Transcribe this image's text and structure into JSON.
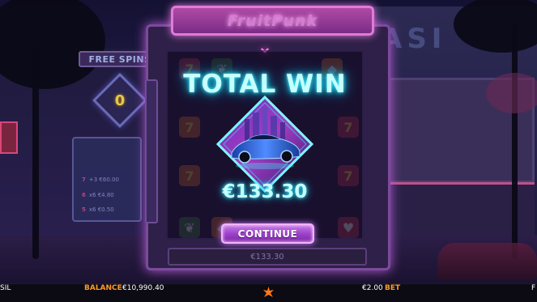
{
  "game": {
    "logo": "FruitPunk",
    "free_spins_label": "FREE SPINS",
    "free_spins_count": "0",
    "paytable": [
      {
        "num": "7",
        "text": "+3 €60.00"
      },
      {
        "num": "6",
        "text": "x6 €4.80"
      },
      {
        "num": "5",
        "text": "x6 €0.50"
      }
    ],
    "background_sign": "ASI"
  },
  "win": {
    "title": "TOTAL WIN",
    "amount": "€133.30",
    "continue_label": "CONTINUE",
    "reel_balance": "€133.30"
  },
  "bottom_bar": {
    "left_fragment": "SIL",
    "balance_label": "BALANCE",
    "balance_value": "€10,990.40",
    "bet_value": "€2.00",
    "bet_label": "BET",
    "right_fragment": "F"
  },
  "colors": {
    "accent_cyan": "#3ff0ff",
    "button_purple": "#9a3fc6",
    "label_orange": "#ff9a24",
    "machine_frame": "#7b4b9a"
  },
  "icons": [
    "provider-logo-icon",
    "sports-car-icon",
    "chevron-down-icon"
  ]
}
